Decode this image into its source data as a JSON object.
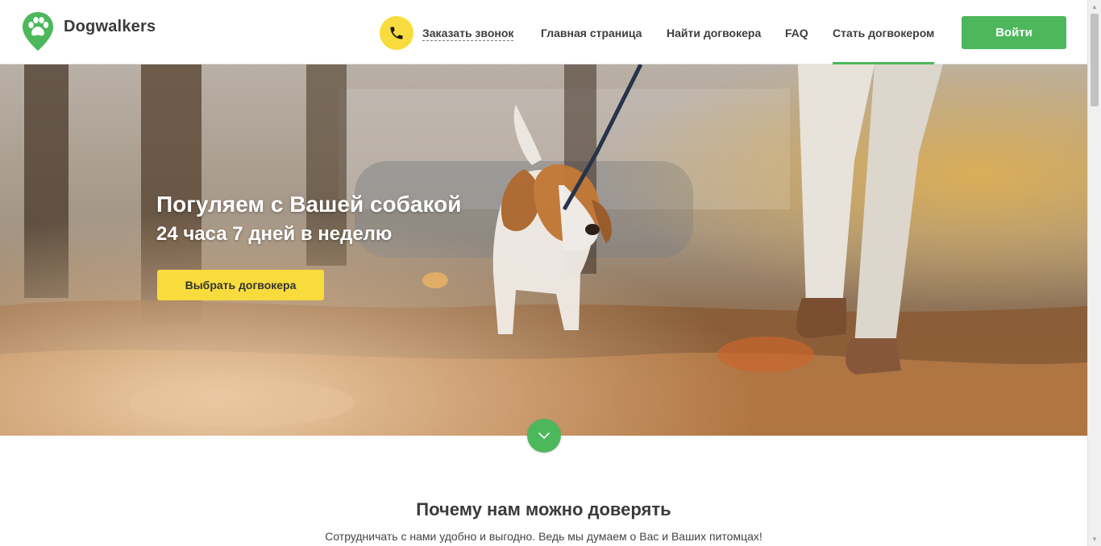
{
  "header": {
    "brand": "Dogwalkers",
    "call_label": "Заказать звонок",
    "nav": [
      {
        "label": "Главная страница"
      },
      {
        "label": "Найти догвокера"
      },
      {
        "label": "FAQ"
      },
      {
        "label": "Стать догвокером",
        "active": true
      }
    ],
    "login_label": "Войти"
  },
  "hero": {
    "title": "Погуляем с Вашей собакой",
    "subtitle": "24 часа 7 дней в неделю",
    "cta_label": "Выбрать догвокера"
  },
  "trust": {
    "title": "Почему нам можно доверять",
    "text": "Сотрудничать с нами удобно и выгодно. Ведь мы думаем о Вас и Ваших питомцах!"
  },
  "icons": {
    "logo": "paw-pin-icon",
    "call": "phone-icon",
    "scroll": "chevron-down-icon"
  },
  "colors": {
    "brand_green": "#4cb85b",
    "accent_yellow": "#f8dc3d",
    "text_dark": "#3e3e3e"
  }
}
